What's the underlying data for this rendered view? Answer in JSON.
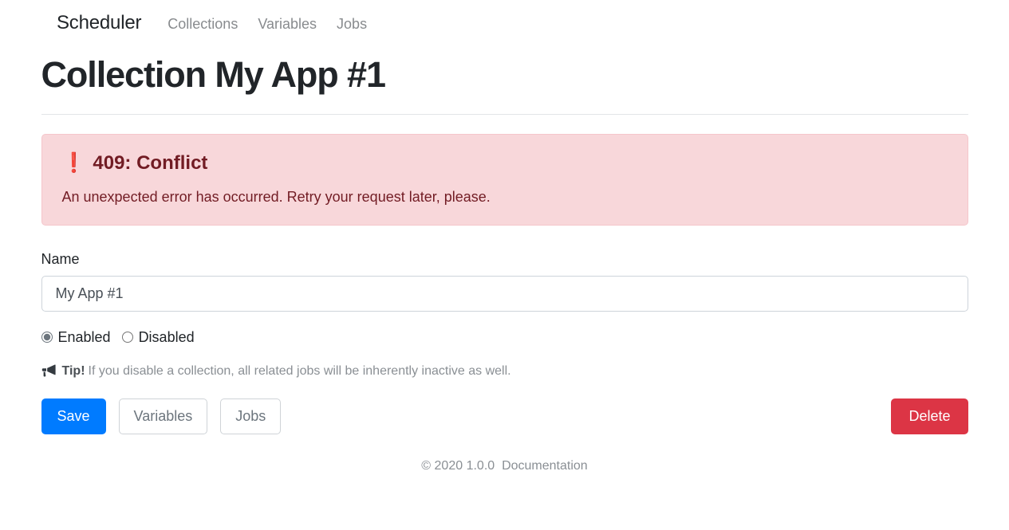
{
  "navbar": {
    "brand": "Scheduler",
    "links": [
      {
        "label": "Collections"
      },
      {
        "label": "Variables"
      },
      {
        "label": "Jobs"
      }
    ]
  },
  "page": {
    "title": "Collection My App #1"
  },
  "alert": {
    "icon": "exclamation-icon",
    "icon_glyph": "❗",
    "heading": "409: Conflict",
    "message": "An unexpected error has occurred. Retry your request later, please.",
    "background_color": "#f8d7da",
    "text_color": "#721c24"
  },
  "form": {
    "name_label": "Name",
    "name_value": "My App #1",
    "name_placeholder": "Name",
    "status": {
      "selected": "enabled",
      "options": [
        {
          "id": "enabled",
          "label": "Enabled",
          "checked": true
        },
        {
          "id": "disabled",
          "label": "Disabled",
          "checked": false
        }
      ]
    },
    "tip": {
      "icon": "bullhorn-icon",
      "strong": "Tip!",
      "text": "If you disable a collection, all related jobs will be inherently inactive as well."
    }
  },
  "actions": {
    "save": "Save",
    "variables": "Variables",
    "jobs": "Jobs",
    "delete": "Delete",
    "primary_color": "#007bff",
    "danger_color": "#dc3545"
  },
  "footer": {
    "copyright": "© 2020 1.0.0",
    "documentation": "Documentation"
  }
}
